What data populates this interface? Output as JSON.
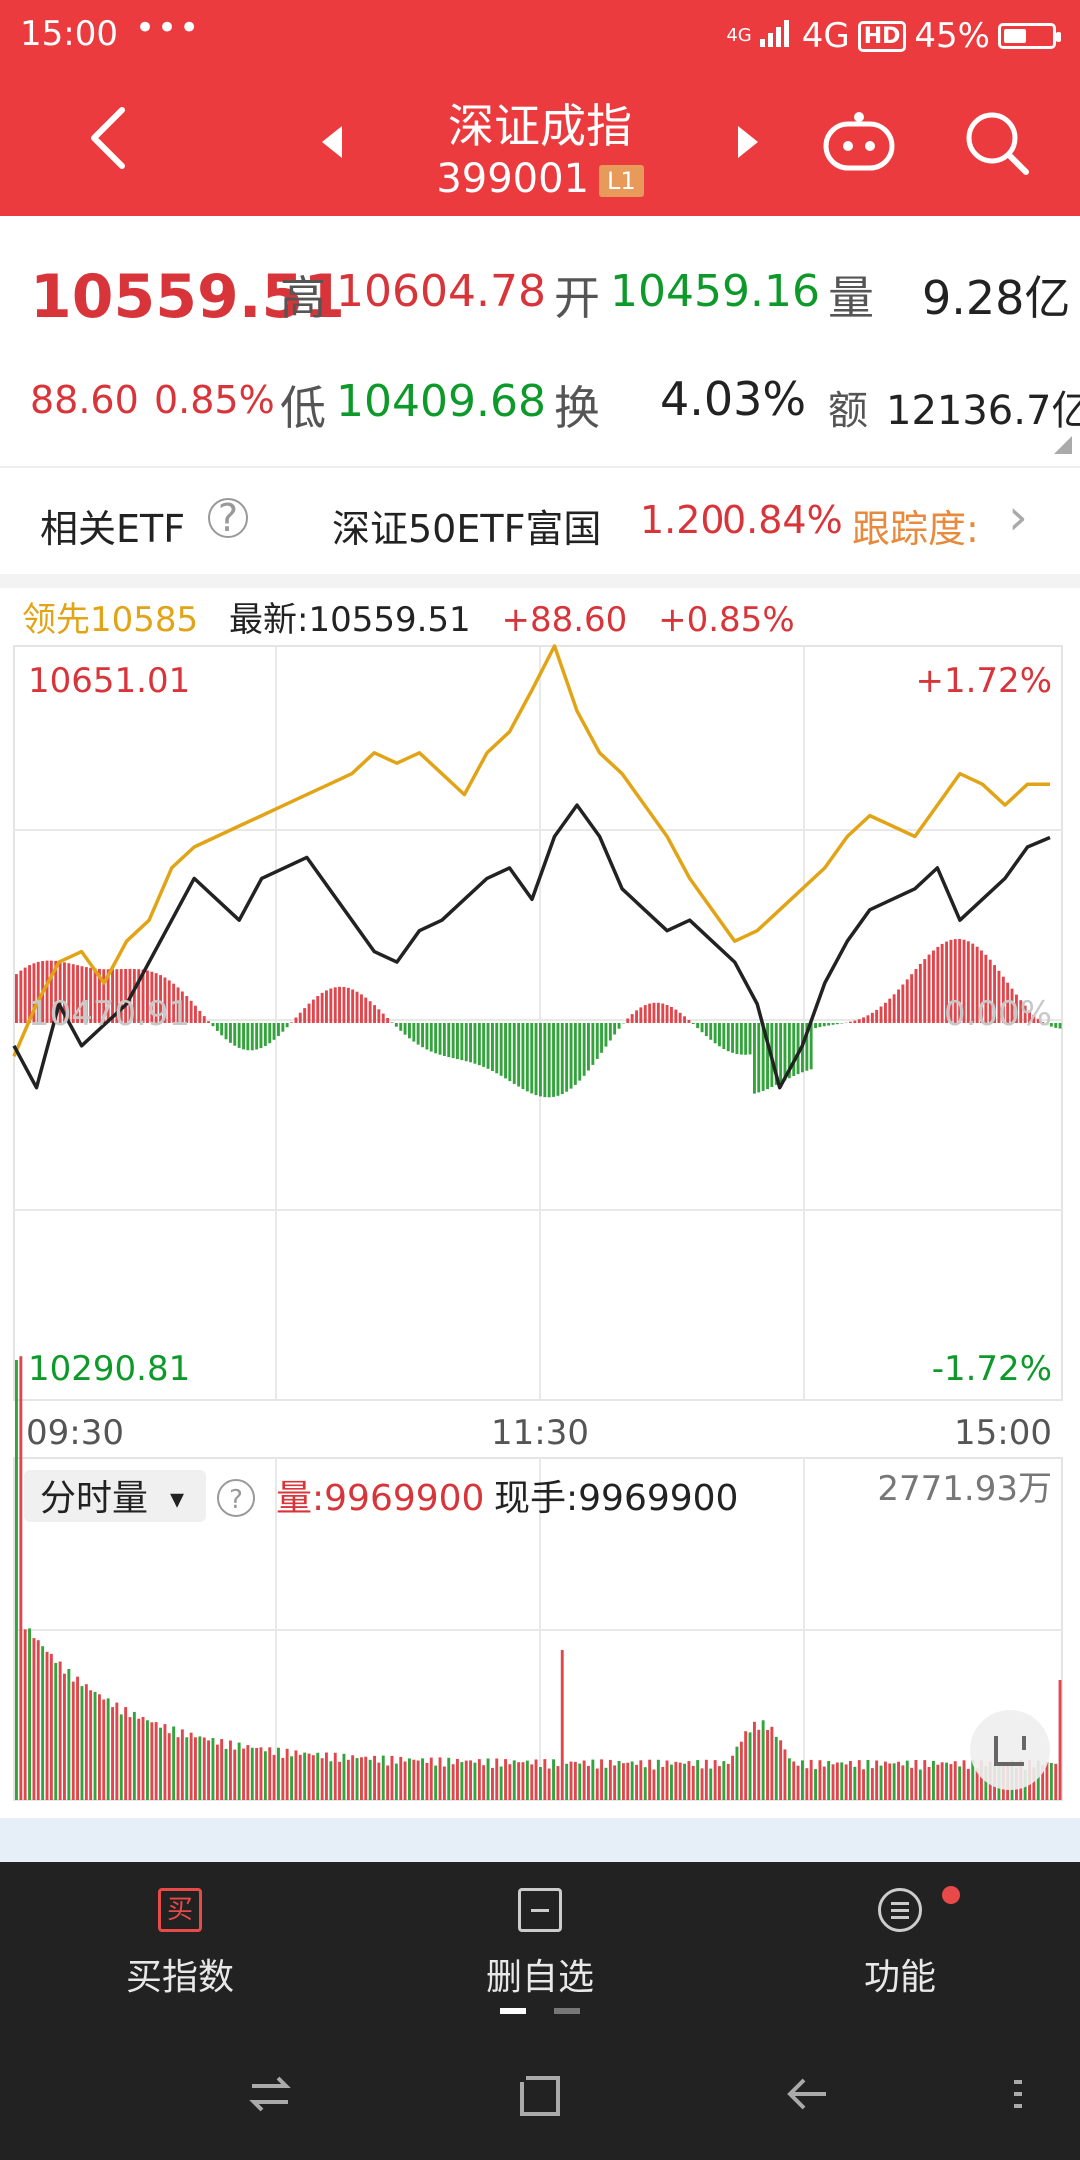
{
  "status": {
    "time": "15:00",
    "dots": "•••",
    "net_small": "4G",
    "net": "4G",
    "hd": "HD",
    "battery": "45%"
  },
  "header": {
    "title": "深证成指",
    "code": "399001",
    "badge": "L1"
  },
  "quote": {
    "price": "10559.51",
    "change": "88.60",
    "change_pct": "0.85%",
    "high_label": "高",
    "high": "10604.78",
    "open_label": "开",
    "open": "10459.16",
    "vol_label": "量",
    "vol": "9.28亿",
    "low_label": "低",
    "low": "10409.68",
    "turn_label": "换",
    "turn": "4.03%",
    "amt_label": "额",
    "amt": "12136.7亿"
  },
  "etf": {
    "label": "相关ETF",
    "help": "?",
    "name": "深证50ETF富国",
    "price": "1.20",
    "pct": "0.84%",
    "track": "跟踪度:",
    "chevron": "›"
  },
  "legend": {
    "lead": "领先10585",
    "latest": "最新:10559.51",
    "chg": "+88.60",
    "pct": "+0.85%"
  },
  "chart_data": {
    "type": "line",
    "y_max": "10651.01",
    "y_min": "10290.81",
    "y_mid": "10470.91",
    "pct_max": "+1.72%",
    "pct_min": "-1.72%",
    "pct_mid": "0.00%",
    "time_labels": [
      "09:30",
      "11:30",
      "15:00"
    ],
    "ylim": [
      10290.81,
      10651.01
    ],
    "series": [
      {
        "values": [
          10455,
          10480,
          10500,
          10505,
          10490,
          10510,
          10520,
          10545,
          10555,
          10560,
          10565,
          10570,
          10575,
          10580,
          10585,
          10590,
          10600,
          10595,
          10600,
          10590,
          10580,
          10600,
          10610,
          10630,
          10651,
          10620,
          10600,
          10590,
          10575,
          10560,
          10540,
          10525,
          10510,
          10515,
          10525,
          10535,
          10545,
          10560,
          10570,
          10565,
          10560,
          10575,
          10590,
          10585,
          10575,
          10585,
          10585
        ]
      },
      {
        "values": [
          10460,
          10440,
          10480,
          10460,
          10470,
          10480,
          10500,
          10520,
          10540,
          10530,
          10520,
          10540,
          10545,
          10550,
          10535,
          10520,
          10505,
          10500,
          10515,
          10520,
          10530,
          10540,
          10545,
          10530,
          10560,
          10575,
          10560,
          10535,
          10525,
          10515,
          10520,
          10510,
          10500,
          10480,
          10440,
          10460,
          10490,
          10510,
          10525,
          10530,
          10535,
          10545,
          10520,
          10530,
          10540,
          10555,
          10559.51
        ]
      }
    ]
  },
  "volume": {
    "selector": "分时量",
    "selector_arrow": "▾",
    "help": "?",
    "vol": "量:9969900",
    "hand": "现手:9969900",
    "max": "2771.93万"
  },
  "nav": {
    "buy_icon": "买",
    "buy": "买指数",
    "del": "删自选",
    "func": "功能"
  }
}
